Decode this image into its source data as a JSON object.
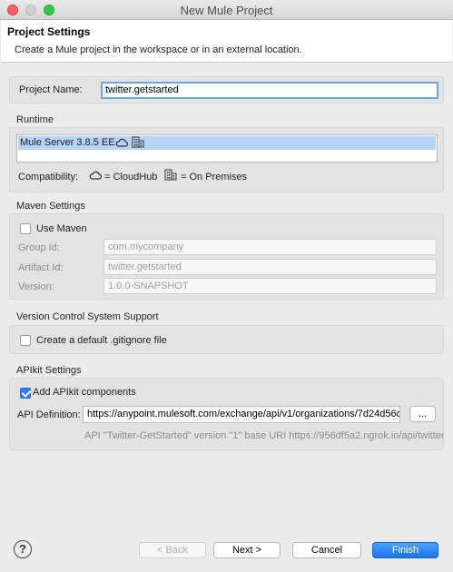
{
  "window": {
    "title": "New Mule Project"
  },
  "header": {
    "title": "Project Settings",
    "description": "Create a Mule project in the workspace or in an external location."
  },
  "project": {
    "name_label": "Project Name:",
    "name_value": "twitter.getstarted"
  },
  "runtime": {
    "section_label": "Runtime",
    "selected_runtime": "Mule Server 3.8.5 EE",
    "compatibility_label": "Compatibility:",
    "cloudhub_legend": "= CloudHub",
    "onprem_legend": "= On Premises"
  },
  "maven": {
    "section_label": "Maven Settings",
    "use_maven_label": "Use Maven",
    "use_maven_checked": false,
    "group_id_label": "Group Id:",
    "group_id_value": "com.mycompany",
    "artifact_id_label": "Artifact Id:",
    "artifact_id_value": "twitter.getstarted",
    "version_label": "Version:",
    "version_value": "1.0.0-SNAPSHOT"
  },
  "vcs": {
    "section_label": "Version Control System Support",
    "gitignore_label": "Create a default .gitignore file",
    "gitignore_checked": false
  },
  "apikit": {
    "section_label": "APIkit Settings",
    "add_components_label": "Add APIkit components",
    "add_components_checked": true,
    "api_definition_label": "API Definition:",
    "api_definition_value": "https://anypoint.mulesoft.com/exchange/api/v1/organizations/7d24d56d",
    "browse_label": "...",
    "info_text": "API \"Twitter-GetStarted\" version \"1\" base URI https://956df5a2.ngrok.io/api/twitter"
  },
  "footer": {
    "help_label": "?",
    "back_label": "< Back",
    "next_label": "Next >",
    "cancel_label": "Cancel",
    "finish_label": "Finish"
  },
  "icons": {
    "cloudhub": "cloud-icon",
    "onprem": "building-icon"
  }
}
